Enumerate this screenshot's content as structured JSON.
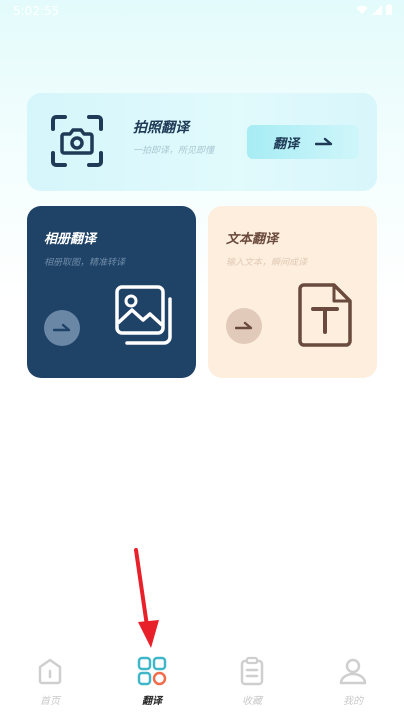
{
  "status_bar": {
    "time": "5:02:55"
  },
  "camera_card": {
    "title": "拍照翻译",
    "subtitle": "一拍即译，所见即懂",
    "button_label": "翻译"
  },
  "album_card": {
    "title": "相册翻译",
    "subtitle": "相册取图，精准转译"
  },
  "text_card": {
    "title": "文本翻译",
    "subtitle": "输入文本，瞬间成译"
  },
  "tab_bar": {
    "tabs": [
      {
        "label": "首页",
        "icon": "home-icon",
        "active": false
      },
      {
        "label": "翻译",
        "icon": "translate-grid-icon",
        "active": true
      },
      {
        "label": "收藏",
        "icon": "clipboard-icon",
        "active": false
      },
      {
        "label": "我的",
        "icon": "user-icon",
        "active": false
      }
    ]
  },
  "colors": {
    "album_bg": "#1f4267",
    "text_bg": "#fdeedd",
    "camera_bg": "#d5f6fb",
    "active_tab_teal": "#3fb7c9",
    "active_tab_orange": "#f26b4a",
    "annotation_red": "#e8202a"
  }
}
